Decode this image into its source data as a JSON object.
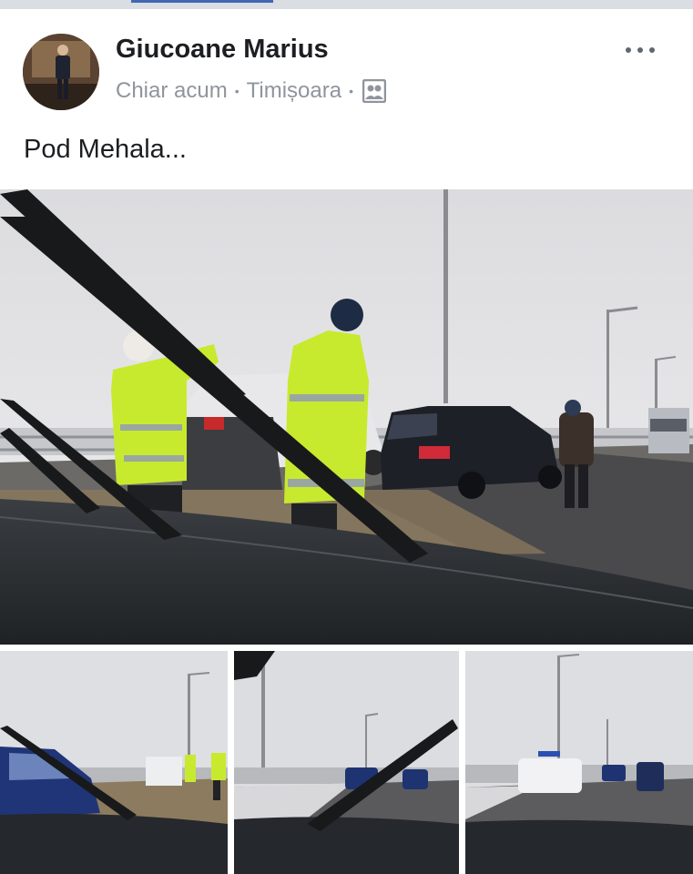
{
  "post": {
    "author": "Giucoane Marius",
    "timestamp": "Chiar acum",
    "location": "Timișoara",
    "separator": "•",
    "text": "Pod Mehala...",
    "privacy_icon": "friends-photo-icon",
    "more_icon": "more-dots-icon"
  },
  "colors": {
    "accent": "#4267b2",
    "name_text": "#1c1e21",
    "meta_text": "#90949c",
    "vest": "#c7ea2e"
  }
}
